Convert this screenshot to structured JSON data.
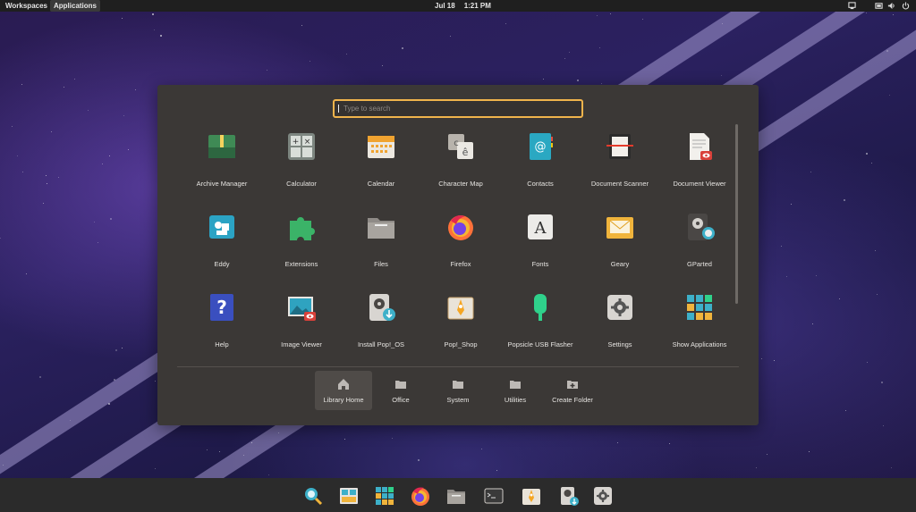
{
  "topbar": {
    "workspaces": "Workspaces",
    "applications": "Applications",
    "date": "Jul 18",
    "time": "1:21 PM",
    "status_icons": [
      "network-icon",
      "battery-icon",
      "volume-icon",
      "power-icon"
    ]
  },
  "launcher": {
    "search_placeholder": "Type to search",
    "apps": [
      {
        "label": "Archive Manager",
        "icon": "archive-icon"
      },
      {
        "label": "Calculator",
        "icon": "calculator-icon"
      },
      {
        "label": "Calendar",
        "icon": "calendar-icon"
      },
      {
        "label": "Character Map",
        "icon": "character-map-icon"
      },
      {
        "label": "Contacts",
        "icon": "contacts-icon"
      },
      {
        "label": "Document Scanner",
        "icon": "scanner-icon"
      },
      {
        "label": "Document Viewer",
        "icon": "document-viewer-icon"
      },
      {
        "label": "Eddy",
        "icon": "eddy-icon"
      },
      {
        "label": "Extensions",
        "icon": "puzzle-icon"
      },
      {
        "label": "Files",
        "icon": "folder-icon"
      },
      {
        "label": "Firefox",
        "icon": "firefox-icon"
      },
      {
        "label": "Fonts",
        "icon": "fonts-icon"
      },
      {
        "label": "Geary",
        "icon": "mail-icon"
      },
      {
        "label": "GParted",
        "icon": "disk-icon"
      },
      {
        "label": "Help",
        "icon": "help-icon"
      },
      {
        "label": "Image Viewer",
        "icon": "image-viewer-icon"
      },
      {
        "label": "Install Pop!_OS",
        "icon": "install-icon"
      },
      {
        "label": "Pop!_Shop",
        "icon": "shop-icon"
      },
      {
        "label": "Popsicle USB Flasher",
        "icon": "usb-icon"
      },
      {
        "label": "Settings",
        "icon": "gear-icon"
      },
      {
        "label": "Show Applications",
        "icon": "app-grid-icon"
      }
    ],
    "categories": [
      {
        "label": "Library Home",
        "icon": "home-icon",
        "active": true
      },
      {
        "label": "Office",
        "icon": "folder-icon",
        "active": false
      },
      {
        "label": "System",
        "icon": "folder-icon",
        "active": false
      },
      {
        "label": "Utilities",
        "icon": "folder-icon",
        "active": false
      },
      {
        "label": "Create Folder",
        "icon": "add-folder-icon",
        "active": false
      }
    ]
  },
  "dock": {
    "items": [
      "search-icon",
      "workspaces-icon",
      "app-grid-icon",
      "firefox-icon",
      "files-icon",
      "terminal-icon",
      "shop-icon",
      "install-icon",
      "settings-icon"
    ]
  },
  "colors": {
    "panel": "#3b3836",
    "accent": "#f0b44c",
    "topbar": "#1f1f1f",
    "dock": "#2b2b2b"
  }
}
